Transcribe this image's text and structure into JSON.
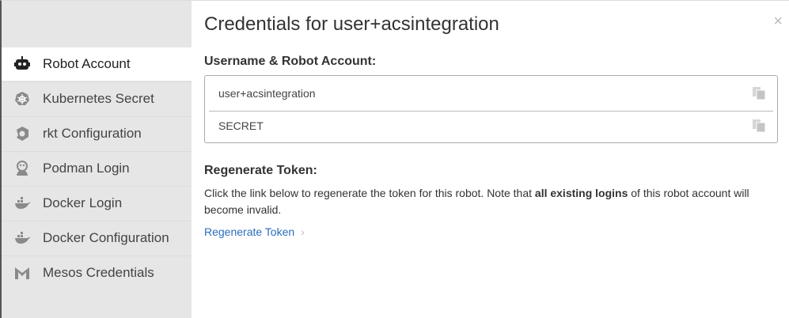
{
  "dialog": {
    "title": "Credentials for user+acsintegration",
    "close_glyph": "×"
  },
  "sidebar": {
    "items": [
      {
        "label": "Robot Account",
        "icon": "robot-icon",
        "active": true
      },
      {
        "label": "Kubernetes Secret",
        "icon": "kubernetes-icon",
        "active": false
      },
      {
        "label": "rkt Configuration",
        "icon": "rkt-icon",
        "active": false
      },
      {
        "label": "Podman Login",
        "icon": "podman-icon",
        "active": false
      },
      {
        "label": "Docker Login",
        "icon": "docker-icon",
        "active": false
      },
      {
        "label": "Docker Configuration",
        "icon": "docker-icon",
        "active": false
      },
      {
        "label": "Mesos Credentials",
        "icon": "mesos-icon",
        "active": false
      }
    ]
  },
  "credentials": {
    "heading": "Username & Robot Account:",
    "username": "user+acsintegration",
    "secret": "SECRET",
    "copy_icon": "copy-icon"
  },
  "regenerate": {
    "heading": "Regenerate Token:",
    "desc_prefix": "Click the link below to regenerate the token for this robot. Note that ",
    "desc_bold": "all existing logins",
    "desc_suffix": " of this robot account will become invalid.",
    "link_label": "Regenerate Token",
    "link_chevron": "›"
  },
  "colors": {
    "sidebar_bg": "#e6e6e6",
    "link": "#2a6ebb",
    "icon_gray": "#8a8a8a"
  }
}
